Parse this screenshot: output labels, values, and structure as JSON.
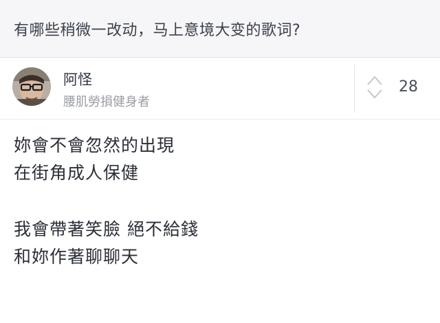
{
  "question": {
    "title": "有哪些稍微一改动，马上意境大变的歌词?"
  },
  "author": {
    "name": "阿怪",
    "bio": "腰肌勞損健身者"
  },
  "vote": {
    "count": "28",
    "icon": "up-down-arrows-icon"
  },
  "answer": {
    "stanza1": [
      "妳會不會忽然的出現",
      "在街角成人保健"
    ],
    "stanza2": [
      "我會帶著笑臉 絕不給錢",
      "和妳作著聊聊天"
    ]
  },
  "colors": {
    "question_bg": "#f6f6f8",
    "text_primary": "#2a2e37",
    "text_secondary": "#9a9ca3",
    "vote_arrow": "#c4c7ce"
  }
}
